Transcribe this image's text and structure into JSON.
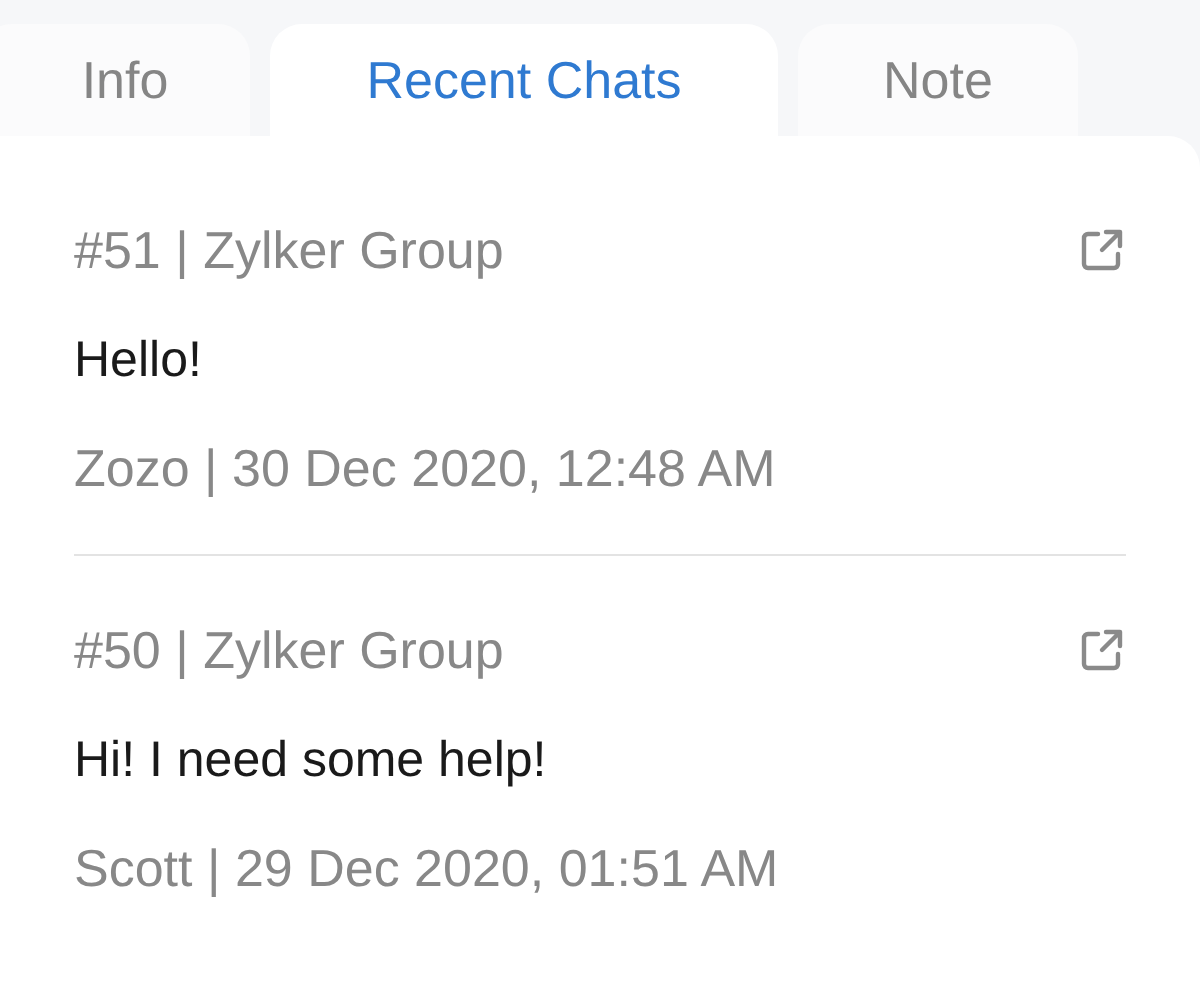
{
  "tabs": [
    {
      "label": "Info",
      "selected": false
    },
    {
      "label": "Recent Chats",
      "selected": true
    },
    {
      "label": "Note",
      "selected": false
    }
  ],
  "chats": [
    {
      "header": "#51 | Zylker Group",
      "message": "Hello!",
      "meta": "Zozo | 30 Dec 2020, 12:48 AM"
    },
    {
      "header": "#50 | Zylker Group",
      "message": "Hi! I need some help!",
      "meta": "Scott | 29 Dec 2020, 01:51 AM"
    }
  ]
}
